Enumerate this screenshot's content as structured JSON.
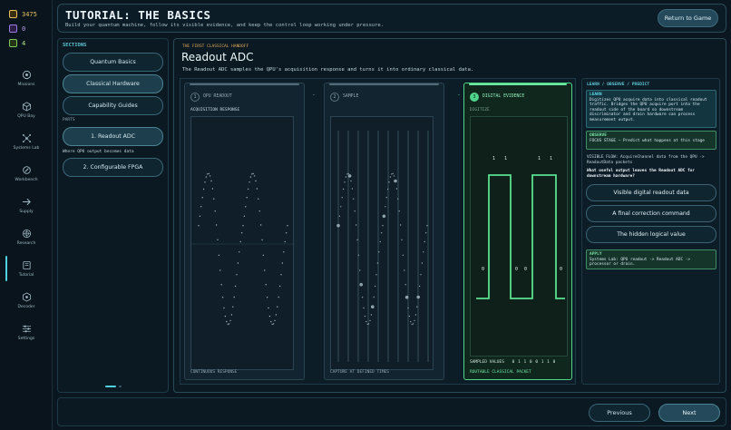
{
  "stats": [
    {
      "icon": "coin-icon",
      "value": "3475",
      "color": "#e6c15a"
    },
    {
      "icon": "qubit-chip-icon",
      "value": "0",
      "color": "#9b7be0"
    },
    {
      "icon": "reward-chip-icon",
      "value": "4",
      "color": "#7ec85a"
    }
  ],
  "nav": [
    {
      "label": "Missions",
      "icon": "target-icon"
    },
    {
      "label": "QPU Bay",
      "icon": "cube-icon"
    },
    {
      "label": "Systems Lab",
      "icon": "network-icon"
    },
    {
      "label": "Workbench",
      "icon": "wrench-icon"
    },
    {
      "label": "Supply",
      "icon": "arrow-right-icon"
    },
    {
      "label": "Research",
      "icon": "radar-icon"
    },
    {
      "label": "Tutorial",
      "icon": "book-icon",
      "active": true
    },
    {
      "label": "Decoder",
      "icon": "hex-icon"
    },
    {
      "label": "Settings",
      "icon": "sliders-icon"
    }
  ],
  "header": {
    "title": "TUTORIAL: THE BASICS",
    "subtitle": "Build your quantum machine, follow its visible evidence, and keep the control loop working under pressure.",
    "return_label": "Return to Game"
  },
  "sections": {
    "title": "SECTIONS",
    "items": [
      "Quantum Basics",
      "Classical Hardware",
      "Capability Guides"
    ],
    "selected": "Classical Hardware",
    "parts_label": "PARTS",
    "parts": [
      "1. Readout ADC",
      "2. Configurable FPGA"
    ],
    "selected_part": "1. Readout ADC",
    "part_hint": "Where QPU output becomes data"
  },
  "lesson": {
    "eyebrow": "THE FIRST CLASSICAL HANDOFF",
    "title": "Readout ADC",
    "description": "The Readout ADC samples the QPU's acquisition response and turns it into ordinary classical data."
  },
  "stages": [
    {
      "step": "1",
      "title": "QPU READOUT",
      "subtitle": "ACQUISITION RESPONSE",
      "footer": "CONTINUOUS RESPONSE"
    },
    {
      "step": "2",
      "title": "SAMPLE",
      "subtitle": "",
      "footer": "CAPTURE AT DEFINED TIMES"
    },
    {
      "step": "3",
      "title": "DIGITAL EVIDENCE",
      "subtitle": "DIGITIZE",
      "footer_values_label": "SAMPLED VALUES",
      "footer_values": "0 1 1 0 0 1 1 0",
      "footer": "ROUTABLE CLASSICAL PACKET",
      "bit_top": [
        "1",
        "1",
        "1",
        "1"
      ],
      "bit_low": [
        "0",
        "0",
        "0",
        "0"
      ]
    }
  ],
  "colors": {
    "accent": "#4fd1e0",
    "evidence_green": "#4fd48b",
    "eyebrow": "#e0a85b"
  },
  "right": {
    "title": "LEARN / OBSERVE / PREDICT",
    "learn": {
      "heading": "LEARN",
      "text": "Digitizes QPU acquire data into classical readout traffic. Bridges the QPU acquire port into the readout side of the board so downstream discriminator and drain hardware can process measurement output."
    },
    "observe": {
      "heading": "OBSERVE",
      "text": "FOCUS STAGE — Predict what happens at this stage"
    },
    "visible_flow": "VISIBLE FLOW: AcquireChannel data from the QPU -> ReadoutData packets",
    "question": "What useful output leaves the Readout ADC for downstream hardware?",
    "options": [
      "Visible digital readout data",
      "A final correction command",
      "The hidden logical value"
    ],
    "apply": {
      "heading": "APPLY",
      "text": "Systems Lab: QPU readout -> Readout ADC -> processor or drain."
    }
  },
  "footer": {
    "previous_label": "Previous",
    "next_label": "Next"
  }
}
